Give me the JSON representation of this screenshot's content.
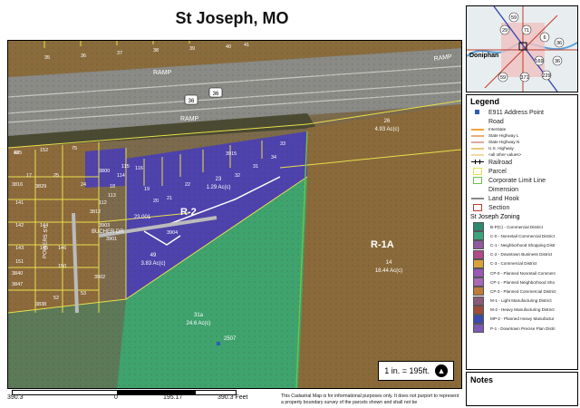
{
  "title": "St Joseph, MO",
  "map": {
    "zones": {
      "r2": "R-2",
      "r1a": "R-1A"
    },
    "ramp_labels": [
      "RAMP",
      "RAMP",
      "RAMP"
    ],
    "highway_shield": "36",
    "street": "BUCHER DR",
    "street2": "POWERS ST",
    "parcel_labels": [
      {
        "label": "26",
        "area": "4.93 Ac(c)"
      },
      {
        "label": "23",
        "area": "1.29 Ac(c)"
      },
      {
        "label": "49",
        "area": "3.83 Ac(c)"
      },
      {
        "label": "14",
        "area": "18.44 Ac(c)"
      },
      {
        "label": "31a",
        "area": "24.6 Ac(c)"
      },
      {
        "label": "23.001",
        "area": ""
      }
    ],
    "address_point": "2507",
    "lot_numbers": [
      "185",
      "152",
      "75",
      "3816",
      "3829",
      "3800",
      "18",
      "19",
      "20",
      "21",
      "22",
      "3904",
      "3812",
      "3903",
      "3901",
      "3902",
      "3840",
      "3847",
      "3838",
      "3915",
      "112",
      "113",
      "114",
      "115",
      "116",
      "141",
      "142",
      "143",
      "144",
      "145",
      "146",
      "150",
      "151",
      "52",
      "53",
      "17",
      "25",
      "24",
      "31",
      "32",
      "33",
      "34",
      "35",
      "36",
      "37",
      "38",
      "39",
      "40",
      "41",
      "42"
    ],
    "scale_text": "1 in. = 195ft."
  },
  "locator": {
    "city_label": "Doniphan",
    "shields": [
      "59",
      "71",
      "29",
      "6",
      "36",
      "36",
      "169",
      "59",
      "371",
      "229"
    ]
  },
  "legend": {
    "title": "Legend",
    "items": [
      {
        "label": "E911 Address Point",
        "kind": "point"
      },
      {
        "label": "Road",
        "kind": "none"
      },
      {
        "label": "Interstate",
        "kind": "line",
        "color": "#f2a33a",
        "small": true
      },
      {
        "label": "State Highway L",
        "kind": "line",
        "color": "#e6b07a",
        "small": true
      },
      {
        "label": "State Highway N",
        "kind": "line",
        "color": "#d9a9a0",
        "small": true
      },
      {
        "label": "U.S. Highway",
        "kind": "line",
        "color": "#e8c87a",
        "small": true
      },
      {
        "label": "<all other values>",
        "kind": "line",
        "color": "#f0d9a0",
        "small": true
      },
      {
        "label": "Railroad",
        "kind": "rail"
      },
      {
        "label": "Parcel",
        "kind": "box",
        "color": "#ffffff",
        "border": "#e6e04a"
      },
      {
        "label": "Corporate Limit Line",
        "kind": "box",
        "color": "#ffffff",
        "border": "#6cc24a"
      },
      {
        "label": "Dimension",
        "kind": "none"
      },
      {
        "label": "Land Hook",
        "kind": "line",
        "color": "#888888"
      },
      {
        "label": "Section",
        "kind": "box",
        "color": "#ffffff",
        "border": "#c0392b"
      }
    ],
    "zoning_title": "St Joseph Zoning",
    "zoning": [
      {
        "label": "B-P(C) - Commercial District",
        "color": "#2d8a6e"
      },
      {
        "label": "C-0 - Nonretail Commercial District",
        "color": "#3aa37a"
      },
      {
        "label": "C-1 - Neighborhood Shopping Distr",
        "color": "#8e5a9e"
      },
      {
        "label": "C-2 - Downtown Business District",
        "color": "#b04a8a"
      },
      {
        "label": "C-3 - Commercial District",
        "color": "#d9a33a"
      },
      {
        "label": "CP-0 - Planned Nonretail Commerc",
        "color": "#9b59b6"
      },
      {
        "label": "CP-1 - Planned Neighborhood Sho",
        "color": "#a86ab5"
      },
      {
        "label": "CP-3 - Planned Commercial District",
        "color": "#c07a3a"
      },
      {
        "label": "M-1 - Light Manufacturing District",
        "color": "#8b5a7a"
      },
      {
        "label": "M-2 - Heavy Manufacturing District",
        "color": "#a04a3a"
      },
      {
        "label": "MP-2 - Planned Heavy Manufactur",
        "color": "#3a4ab0"
      },
      {
        "label": "P-1 - Downtown Precise Plan Distri",
        "color": "#7a5ab5"
      }
    ]
  },
  "notes": {
    "title": "Notes"
  },
  "scalebar": {
    "labels": [
      "390.3",
      "0",
      "195.17",
      "390.3 Feet"
    ]
  },
  "disclaimer": "This Cadastral Map is for informational purposes only. It does not purport to represent a property boundary survey of the parcels shown and shall not be"
}
